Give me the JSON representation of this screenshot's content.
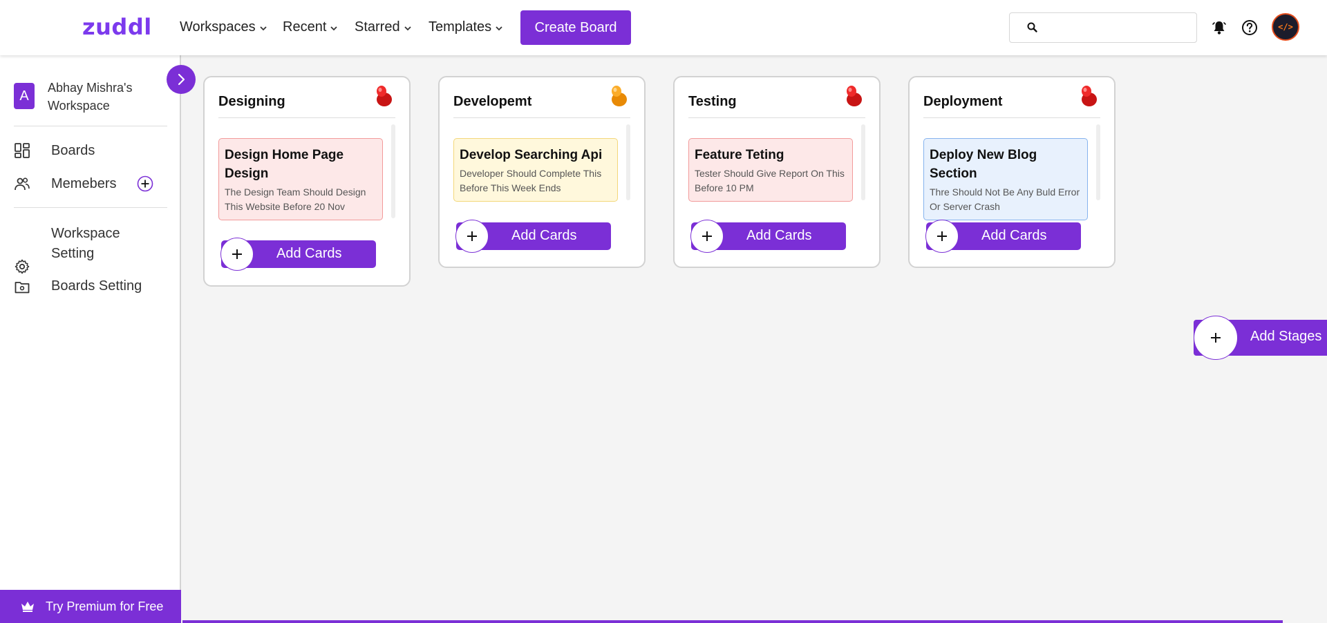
{
  "header": {
    "logo": "zuddl",
    "nav": [
      {
        "label": "Workspaces"
      },
      {
        "label": "Recent"
      },
      {
        "label": "Starred"
      },
      {
        "label": "Templates"
      }
    ],
    "create_board_label": "Create Board",
    "search": {
      "placeholder": "",
      "value": ""
    },
    "icons": [
      "bell-icon",
      "help-icon"
    ],
    "avatar_text": "</>"
  },
  "sidebar": {
    "workspace_initial": "A",
    "workspace_name": "Abhay Mishra's Workspace",
    "items": [
      {
        "label": "Boards",
        "icon": "boards-grid-icon"
      },
      {
        "label": "Memebers",
        "icon": "members-icon"
      },
      {
        "label": "Workspace Setting",
        "icon": "gear-icon"
      },
      {
        "label": "Boards Setting",
        "icon": "folder-settings-icon"
      }
    ],
    "premium_label": "Try Premium for Free"
  },
  "stages": [
    {
      "title": "Designing",
      "pin_color": "#e11d1d",
      "card": {
        "title": "Design Home Page Design",
        "description": "The Design Team Should Design This Website Before 20 Nov",
        "tone": "red"
      },
      "add_label": "Add Cards"
    },
    {
      "title": "Developemt",
      "pin_color": "#f59e0b",
      "card": {
        "title": "Develop Searching Api",
        "description": "Developer Should Complete This Before This Week Ends",
        "tone": "yellow"
      },
      "add_label": "Add Cards"
    },
    {
      "title": "Testing",
      "pin_color": "#e11d1d",
      "card": {
        "title": "Feature Teting",
        "description": "Tester Should Give Report On This Before 10 PM",
        "tone": "red"
      },
      "add_label": "Add Cards"
    },
    {
      "title": "Deployment",
      "pin_color": "#e11d1d",
      "card": {
        "title": "Deploy New Blog Section",
        "description": "Thre Should Not Be Any Buld Error Or Server Crash",
        "tone": "blue"
      },
      "add_label": "Add Cards"
    }
  ],
  "add_stages_label": "Add Stages",
  "colors": {
    "accent": "#7b2fd6"
  }
}
